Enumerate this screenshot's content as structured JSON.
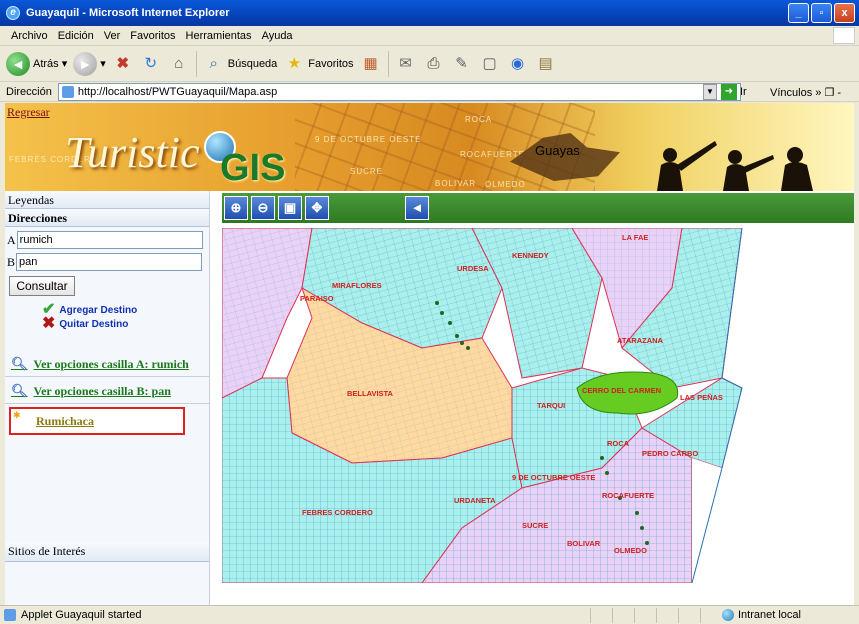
{
  "window": {
    "title": "Guayaquil - Microsoft Internet Explorer",
    "controls": [
      "_",
      "▫",
      "x"
    ]
  },
  "menu": [
    "Archivo",
    "Edición",
    "Ver",
    "Favoritos",
    "Herramientas",
    "Ayuda"
  ],
  "toolbar": {
    "back_label": "Atrás",
    "search_label": "Búsqueda",
    "favorites_label": "Favoritos"
  },
  "address": {
    "label": "Dirección",
    "url": "http://localhost/PWTGuayaquil/Mapa.asp",
    "go_label": "Ir",
    "links_label": "Vínculos"
  },
  "banner": {
    "back_link": "Regresar",
    "logo_text": "Turistic",
    "logo_gis": "GIS",
    "region": "Guayas",
    "street_labels": [
      "9 DE OCTUBRE OESTE",
      "ROCAFUERTE",
      "SUCRE",
      "BOLIVAR",
      "OLMEDO",
      "FEBRES CORDERO",
      "ROCA"
    ]
  },
  "left_panel": {
    "legend_header": "Leyendas",
    "directions_header": "Direcciones",
    "field_a_label": "A",
    "field_a_value": "rumich",
    "field_b_label": "B",
    "field_b_value": "pan",
    "consult_button": "Consultar",
    "add_destination": "Agregar Destino",
    "remove_destination": "Quitar Destino",
    "option_a": "Ver opciones casilla A:  rumich",
    "option_b": "Ver opciones casilla B:  pan",
    "result_link": "Rumichaca",
    "places_header": "Sitios de Interés"
  },
  "map_toolbar": {
    "tools": [
      "zoom-in",
      "zoom-out",
      "full-extent",
      "pan",
      "back"
    ]
  },
  "map": {
    "labels": [
      "LA FAE",
      "KENNEDY",
      "MIRAFLORES",
      "URDESA",
      "PARAISO",
      "ATARAZANA",
      "BELLAVISTA",
      "TARQUI",
      "CERRO DEL CARMEN",
      "LAS PEÑAS",
      "ROCA",
      "PEDRO CARBO",
      "9 DE OCTUBRE OESTE",
      "ROCAFUERTE",
      "URDANETA",
      "FEBRES CORDERO",
      "SUCRE",
      "BOLIVAR",
      "OLMEDO"
    ],
    "colors": {
      "water": "#ffffff",
      "cyan_zone": "#9ff0ee",
      "orange_zone": "#ffd9a0",
      "purple_zone": "#e6c8f5",
      "green_hill": "#66cc22",
      "boundary": "#e03050"
    }
  },
  "status": {
    "text": "Applet Guayaquil started",
    "zone": "Intranet local"
  }
}
